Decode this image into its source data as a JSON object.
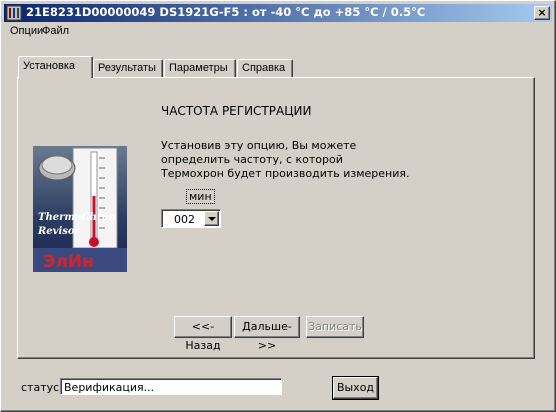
{
  "window": {
    "title": "21E8231D00000049    DS1921G-F5 : от -40 °C до +85 °C / 0.5°C",
    "close_glyph": "×"
  },
  "menu": {
    "items": [
      {
        "label": "Опции"
      },
      {
        "label": "Файл"
      }
    ]
  },
  "tabs": [
    {
      "label": "Установка",
      "active": true
    },
    {
      "label": "Результаты",
      "active": false
    },
    {
      "label": "Параметры",
      "active": false
    },
    {
      "label": "Справка",
      "active": false
    }
  ],
  "panel": {
    "heading": "ЧАСТОТА РЕГИСТРАЦИИ",
    "description_lines": [
      "Установив эту опцию, Вы можете",
      "определить частоту, с которой",
      "Термохрон будет производить измерения."
    ],
    "unit_label": "мин",
    "interval_select": {
      "value": "002"
    },
    "logo": {
      "brand_line1": "ThermoChron",
      "brand_line2": "Revisor",
      "company": "ЭлИн"
    },
    "buttons": {
      "back": "<<-Назад",
      "next": "Дальше->>",
      "write": "Записать"
    }
  },
  "footer": {
    "status_label": "статус",
    "status_value": "Верификация...",
    "exit_label": "Выход"
  },
  "colors": {
    "titlebar_start": "#0a246a",
    "titlebar_end": "#a6caf0",
    "face": "#d4d0c8",
    "logo_red": "#d2232a"
  }
}
